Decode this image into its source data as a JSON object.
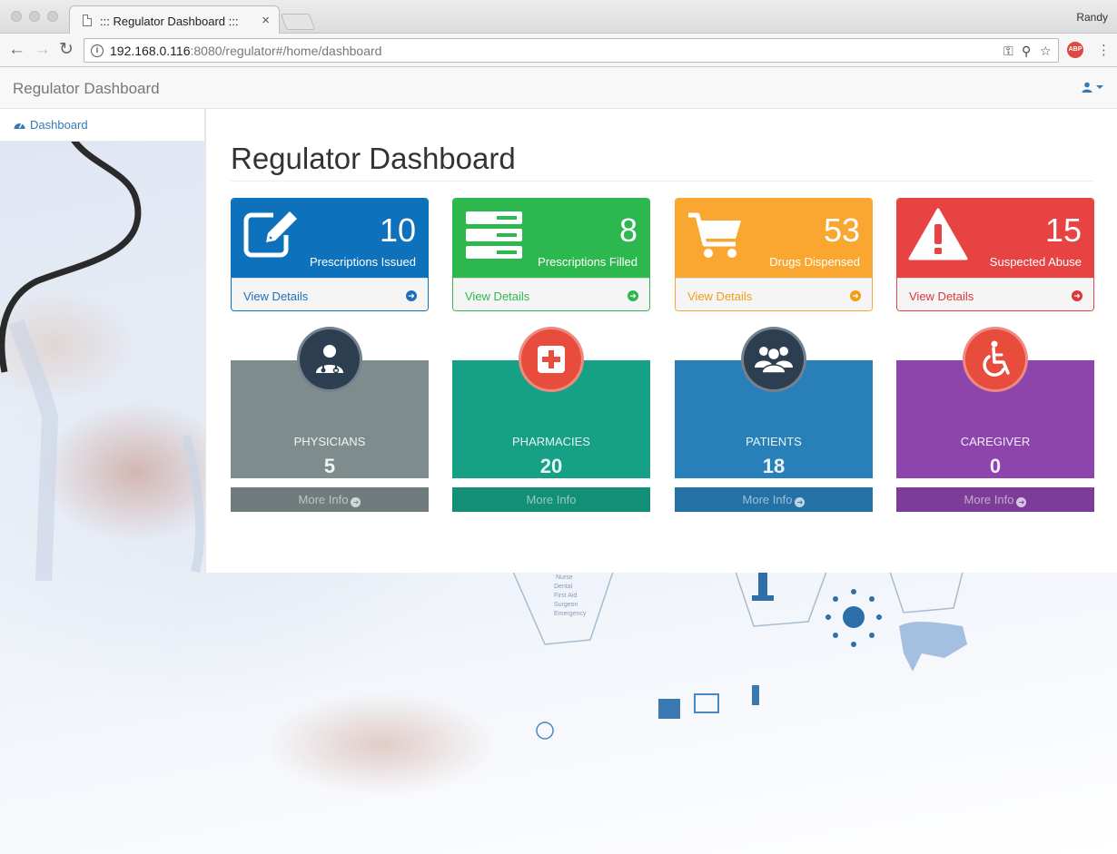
{
  "browser": {
    "tab_title": "::: Regulator Dashboard :::",
    "tab_close": "×",
    "profile_name": "Randy",
    "url_host": "192.168.0.116",
    "url_rest": ":8080/regulator#/home/dashboard",
    "back": "←",
    "forward": "→",
    "reload": "↻",
    "info": "i",
    "key_icon": "⚿",
    "zoom_icon": "⚲",
    "star_icon": "☆",
    "abp": "ABP",
    "menu": "⋮"
  },
  "navbar": {
    "brand": "Regulator Dashboard"
  },
  "sidebar": {
    "items": [
      {
        "label": "Dashboard",
        "icon": "dashboard-icon"
      }
    ]
  },
  "page": {
    "title": "Regulator Dashboard"
  },
  "panels": [
    {
      "count": "10",
      "label": "Prescriptions Issued",
      "link": "View Details",
      "color": "#0d72bb",
      "link_color": "#1f6fb6",
      "icon": "edit-icon"
    },
    {
      "count": "8",
      "label": "Prescriptions Filled",
      "link": "View Details",
      "color": "#2db84f",
      "link_color": "#2db84f",
      "icon": "server-icon"
    },
    {
      "count": "53",
      "label": "Drugs Dispensed",
      "link": "View Details",
      "color": "#faa732",
      "link_color": "#f39c12",
      "icon": "cart-icon"
    },
    {
      "count": "15",
      "label": "Suspected Abuse",
      "link": "View Details",
      "color": "#e84343",
      "link_color": "#d9383a",
      "icon": "warning-icon"
    }
  ],
  "info_boxes": [
    {
      "label": "PHYSICIANS",
      "count": "5",
      "link": "More Info",
      "bg": "#7f8c8d",
      "foot": "#6f7b7c",
      "circle": "#2c3e50",
      "icon": "doctor-icon"
    },
    {
      "label": "PHARMACIES",
      "count": "20",
      "link": "More Info",
      "bg": "#16a085",
      "foot": "#128f76",
      "circle": "#e74c3c",
      "icon": "medkit-icon"
    },
    {
      "label": "PATIENTS",
      "count": "18",
      "link": "More Info",
      "bg": "#2980b9",
      "foot": "#2471a5",
      "circle": "#2c3e50",
      "icon": "users-icon"
    },
    {
      "label": "CAREGIVER",
      "count": "0",
      "link": "More Info",
      "bg": "#8e44ad",
      "foot": "#7d3c98",
      "circle": "#e74c3c",
      "icon": "wheelchair-icon"
    }
  ]
}
